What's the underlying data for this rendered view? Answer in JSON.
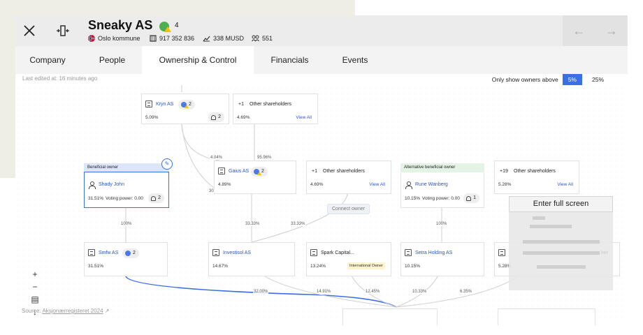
{
  "header": {
    "company_name": "Sneaky AS",
    "risk_count": "4",
    "municipality": "Oslo kommune",
    "org_number": "917 352 836",
    "revenue": "338 MUSD",
    "employees": "551"
  },
  "tabs": [
    {
      "label": "Company"
    },
    {
      "label": "People"
    },
    {
      "label": "Ownership & Control"
    },
    {
      "label": "Financials"
    },
    {
      "label": "Events"
    }
  ],
  "last_edited": "Last edited at: 16 minutes ago",
  "filter": {
    "label": "Only show owners above",
    "option_a": "5%",
    "option_b": "25%"
  },
  "nodes": {
    "kryn": {
      "name": "Kryn AS",
      "pct": "5.09%",
      "badge": "2",
      "people": "2"
    },
    "other1": {
      "plus": "+1",
      "label": "Other shareholders",
      "pct": "4.69%",
      "link": "View All"
    },
    "shady": {
      "tag": "Beneficial owner",
      "name": "Shady John",
      "pct": "31.51%",
      "voting": "Voting power: 0.00",
      "people": "2"
    },
    "gaius": {
      "name": "Gaius AS",
      "pct": "4.89%",
      "badge": "2"
    },
    "other2": {
      "plus": "+1",
      "label": "Other shareholders",
      "pct": "4.69%",
      "link": "View All"
    },
    "rune": {
      "tag": "Alternative beneficial owner",
      "name": "Rune Wanberg",
      "pct": "10.15%",
      "voting": "Voting power: 0.00",
      "people": "1"
    },
    "other3": {
      "plus": "+19",
      "label": "Other shareholders",
      "pct": "5.28%",
      "link": "View All"
    },
    "smfw": {
      "name": "Smfw AS",
      "pct": "31.51%",
      "badge": "2"
    },
    "investsol": {
      "name": "Investisol AS",
      "pct": "14.67%"
    },
    "spark": {
      "name": "Spark Capital...",
      "pct": "13.24%",
      "tag": "International Owner"
    },
    "setra": {
      "name": "Setra Holding AS",
      "pct": "10.15%"
    },
    "partial": {
      "pct": "5.28%",
      "label": "her"
    }
  },
  "edge_labels": {
    "e1": "4.04%",
    "e2": "95.96%",
    "e3": "30",
    "e4": "100%",
    "e5": "33.33%",
    "e6": "33.33%",
    "e7": "100%",
    "e8": "32.00%",
    "e9": "14.91%",
    "e10": "12.45%",
    "e11": "10.33%",
    "e12": "6.35%"
  },
  "connect_owner": "Connect owner",
  "fullscreen_label": "Enter full screen",
  "zoom": {
    "in": "+",
    "out": "−",
    "fit": "▤",
    "down": "↓"
  },
  "source": {
    "prefix": "Source:",
    "link": "Aksjonærregisteret 2024"
  },
  "colors": {
    "accent": "#3b6fe6",
    "beneficial_tag": "#dbe6fb",
    "alt_tag": "#e3f3e6",
    "intl_tag": "#fdf3cf"
  }
}
